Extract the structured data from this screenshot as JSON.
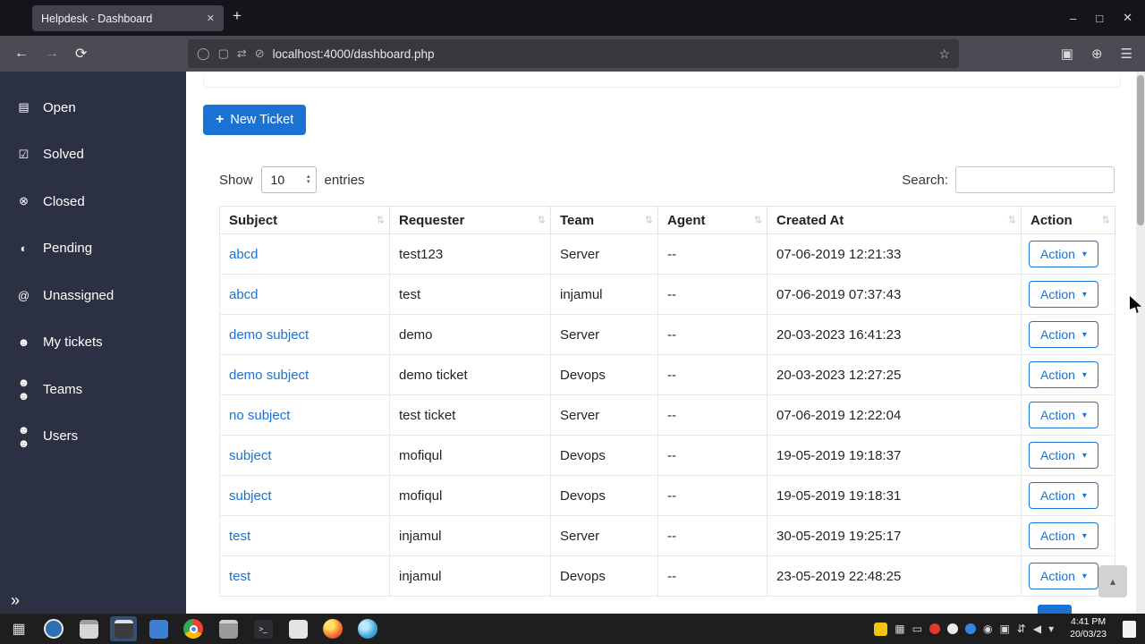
{
  "colors": {
    "accent_blue": "#1a73d2",
    "sidebar_bg": "#2b3142",
    "browser_tab_strip": "#15141b",
    "browser_toolbar": "#4c4b53",
    "taskbar_bg": "#1e1e1e",
    "link_blue": "#1a73d2"
  },
  "browser": {
    "tab_title": "Helpdesk - Dashboard",
    "url": "localhost:4000/dashboard.php",
    "icons": {
      "tab_close": "✕",
      "new_tab": "+",
      "minimize": "–",
      "maximize": "□",
      "window_close": "✕",
      "back": "←",
      "forward": "→",
      "reload": "⟳",
      "tracking": "◯",
      "page": "▢",
      "switch": "⇄",
      "shield_off": "⊘",
      "star": "☆",
      "pocket": "▣",
      "globe": "⊕",
      "menu": "☰"
    }
  },
  "sidebar": {
    "items": [
      {
        "label": "Open",
        "glyph": "▤"
      },
      {
        "label": "Solved",
        "glyph": "☑"
      },
      {
        "label": "Closed",
        "glyph": "⊗"
      },
      {
        "label": "Pending",
        "glyph": "◐"
      },
      {
        "label": "Unassigned",
        "glyph": "@"
      },
      {
        "label": "My tickets",
        "glyph": "☻"
      },
      {
        "label": "Teams",
        "glyph": "☻☻"
      },
      {
        "label": "Users",
        "glyph": "☻☻"
      }
    ],
    "collapse_glyph": "»"
  },
  "main": {
    "new_ticket": {
      "icon": "+",
      "label": "New Ticket"
    },
    "controls": {
      "show_label": "Show",
      "page_size": "10",
      "entries_label": "entries",
      "search_label": "Search:",
      "search_value": ""
    },
    "table": {
      "sort_glyph": "⇅",
      "action_caret": "▾",
      "headers": [
        {
          "label": "Subject"
        },
        {
          "label": "Requester"
        },
        {
          "label": "Team"
        },
        {
          "label": "Agent"
        },
        {
          "label": "Created At"
        },
        {
          "label": "Action"
        }
      ],
      "rows": [
        {
          "subject": "abcd",
          "requester": "test123",
          "team": "Server",
          "agent": "--",
          "created_at": "07-06-2019 12:21:33",
          "action": "Action"
        },
        {
          "subject": "abcd",
          "requester": "test",
          "team": "injamul",
          "agent": "--",
          "created_at": "07-06-2019 07:37:43",
          "action": "Action"
        },
        {
          "subject": "demo subject",
          "requester": "demo",
          "team": "Server",
          "agent": "--",
          "created_at": "20-03-2023 16:41:23",
          "action": "Action"
        },
        {
          "subject": "demo subject",
          "requester": "demo ticket",
          "team": "Devops",
          "agent": "--",
          "created_at": "20-03-2023 12:27:25",
          "action": "Action"
        },
        {
          "subject": "no subject",
          "requester": "test ticket",
          "team": "Server",
          "agent": "--",
          "created_at": "07-06-2019 12:22:04",
          "action": "Action"
        },
        {
          "subject": "subject",
          "requester": "mofiqul",
          "team": "Devops",
          "agent": "--",
          "created_at": "19-05-2019 19:18:37",
          "action": "Action"
        },
        {
          "subject": "subject",
          "requester": "mofiqul",
          "team": "Devops",
          "agent": "--",
          "created_at": "19-05-2019 19:18:31",
          "action": "Action"
        },
        {
          "subject": "test",
          "requester": "injamul",
          "team": "Server",
          "agent": "--",
          "created_at": "30-05-2019 19:25:17",
          "action": "Action"
        },
        {
          "subject": "test",
          "requester": "injamul",
          "team": "Devops",
          "agent": "--",
          "created_at": "23-05-2019 22:48:25",
          "action": "Action"
        }
      ]
    },
    "scroll_top_glyph": "▴"
  },
  "taskbar": {
    "launchers": [
      "keyboard",
      "screenshot-tool",
      "files",
      "terminal-window-active",
      "software-center",
      "chrome",
      "window",
      "terminal",
      "text-editor",
      "firefox",
      "web-globe"
    ],
    "tray_icons": [
      "notes",
      "keyboard-indicator",
      "display",
      "record-status",
      "status-white",
      "status-blue",
      "screen-share",
      "camera",
      "network-arrows",
      "volume",
      "tray-expander"
    ],
    "terminal_glyph": ">_",
    "clock_time": "4:41 PM",
    "clock_date": "20/03/23"
  }
}
